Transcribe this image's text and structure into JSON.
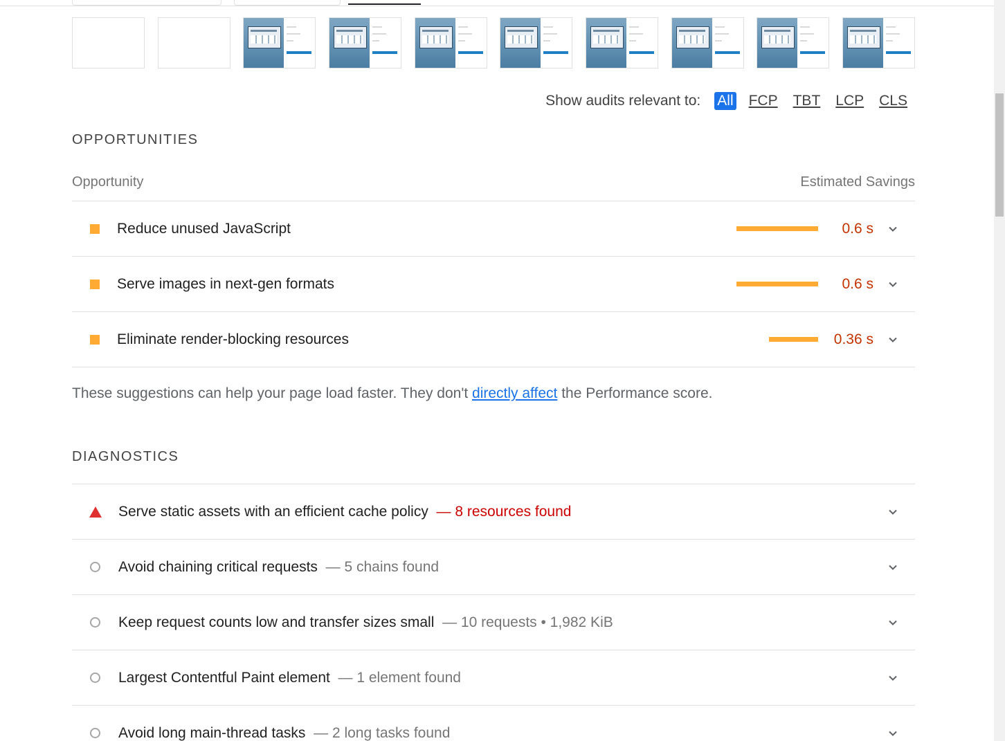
{
  "filter": {
    "label": "Show audits relevant to:",
    "chips": [
      "All",
      "FCP",
      "TBT",
      "LCP",
      "CLS"
    ]
  },
  "opportunities": {
    "title": "OPPORTUNITIES",
    "col_left": "Opportunity",
    "col_right": "Estimated Savings",
    "items": [
      {
        "title": "Reduce unused JavaScript",
        "savings": "0.6 s",
        "savings_fraction": 1.0
      },
      {
        "title": "Serve images in next-gen formats",
        "savings": "0.6 s",
        "savings_fraction": 1.0
      },
      {
        "title": "Eliminate render-blocking resources",
        "savings": "0.36 s",
        "savings_fraction": 0.6
      }
    ],
    "note_before": "These suggestions can help your page load faster. They don't ",
    "note_link": "directly affect",
    "note_after": " the Performance score."
  },
  "diagnostics": {
    "title": "DIAGNOSTICS",
    "items": [
      {
        "title": "Serve static assets with an efficient cache policy",
        "detail": "— 8 resources found",
        "status": "fail"
      },
      {
        "title": "Avoid chaining critical requests",
        "detail": "— 5 chains found",
        "status": "info"
      },
      {
        "title": "Keep request counts low and transfer sizes small",
        "detail": "— 10 requests • 1,982 KiB",
        "status": "info"
      },
      {
        "title": "Largest Contentful Paint element",
        "detail": "— 1 element found",
        "status": "info"
      },
      {
        "title": "Avoid long main-thread tasks",
        "detail": "— 2 long tasks found",
        "status": "info"
      }
    ]
  },
  "colors": {
    "average": "#ffaa33",
    "fail": "#e03131",
    "link": "#1a73e8"
  }
}
